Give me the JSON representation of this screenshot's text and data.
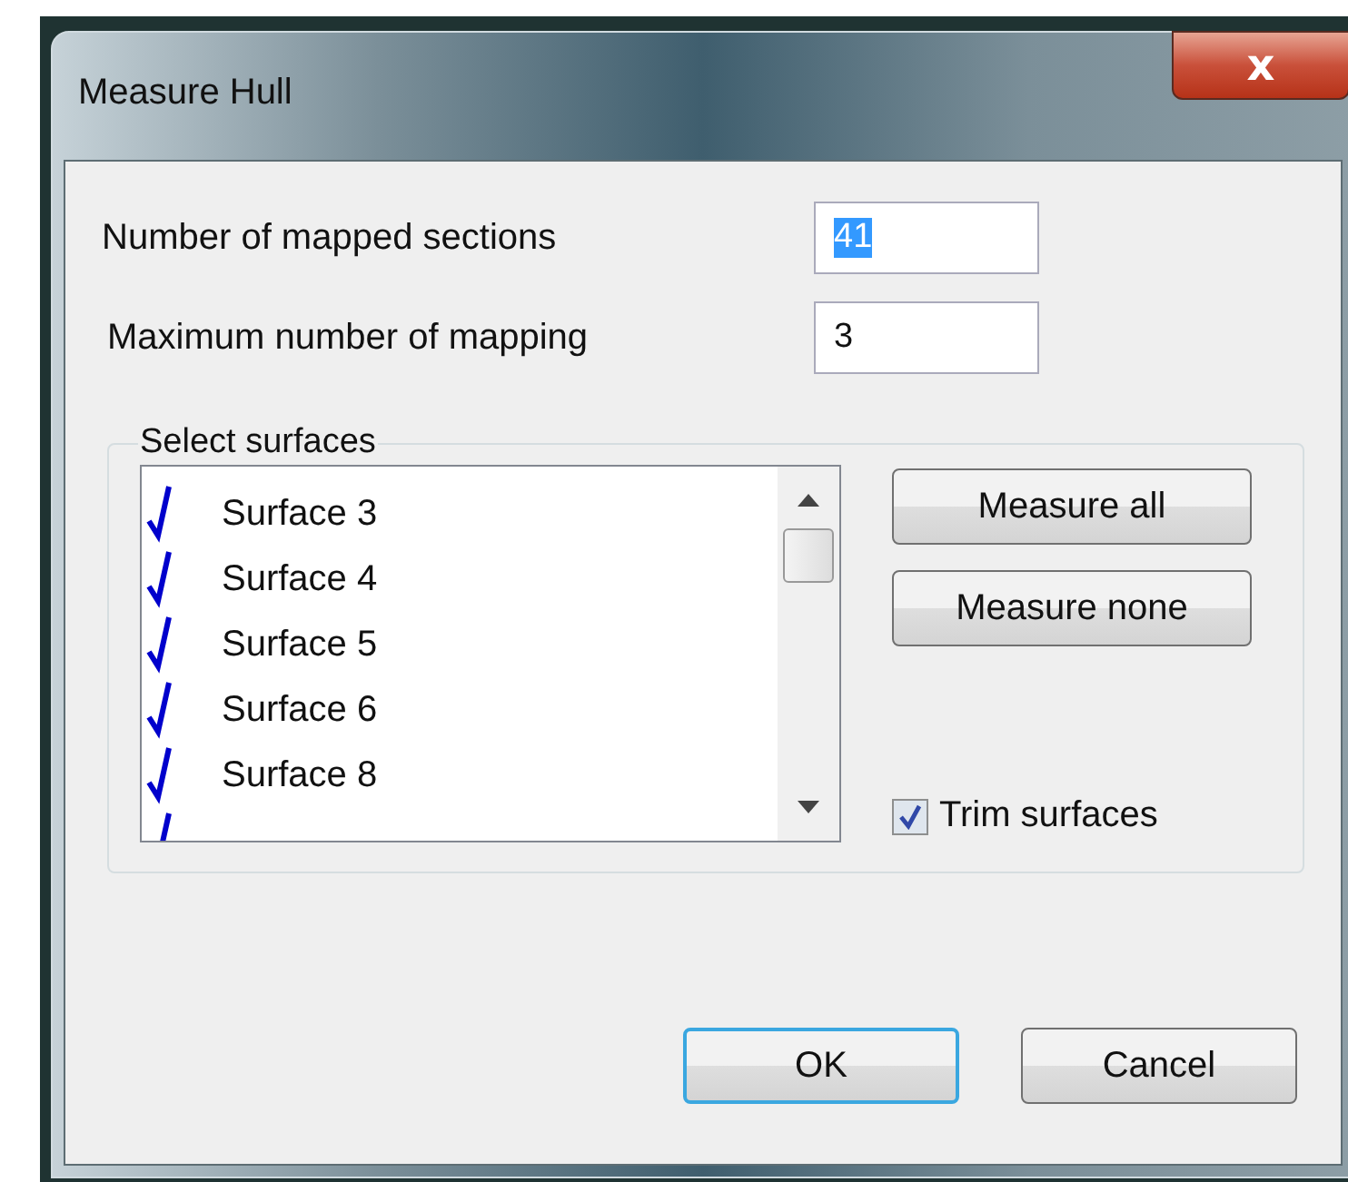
{
  "window": {
    "title": "Measure Hull",
    "close": "x"
  },
  "fields": [
    {
      "label": "Number of mapped sections",
      "value": "41",
      "text_selected": true
    },
    {
      "label": "Maximum number of mapping",
      "value": "3",
      "text_selected": false
    }
  ],
  "surfaces": {
    "title": "Select surfaces",
    "items": [
      {
        "label": "Surface 3",
        "checked": true
      },
      {
        "label": "Surface 4",
        "checked": true
      },
      {
        "label": "Surface 5",
        "checked": true
      },
      {
        "label": "Surface 6",
        "checked": true
      },
      {
        "label": "Surface 8",
        "checked": true
      },
      {
        "checked": true
      }
    ],
    "buttons": [
      "Measure all",
      "Measure none"
    ],
    "trim": {
      "label": "Trim surfaces",
      "checked": true
    }
  },
  "buttons": [
    {
      "label": "OK",
      "default": true
    },
    {
      "label": "Cancel",
      "default": false
    }
  ]
}
